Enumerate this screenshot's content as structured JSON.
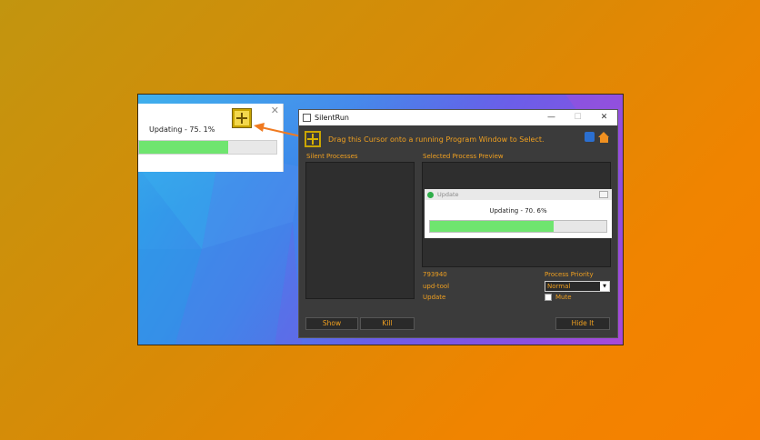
{
  "mini_popup": {
    "text": "Updating - 75. 1%",
    "close": "✕",
    "progress": 0.65
  },
  "window": {
    "title": "SilentRun",
    "minimize": "—",
    "maximize": "☐",
    "close": "✕",
    "instruction": "Drag this Cursor onto a running Program Window to Select.",
    "silent_processes_label": "Silent Processes",
    "preview_label": "Selected Process Preview",
    "preview_window": {
      "title": "Update",
      "text": "Updating - 70. 6%",
      "progress": 0.7
    },
    "process_id": "793940",
    "process_name": "upd-tool",
    "process_title": "Update",
    "priority_label": "Process Priority",
    "priority_value": "Normal",
    "mute_label": "Mute",
    "show_button": "Show",
    "kill_button": "Kill",
    "hide_button": "Hide It"
  },
  "colors": {
    "accent": "#f0a020",
    "progress_fill": "#6fe56f",
    "window_bg": "#3b3b3b"
  }
}
